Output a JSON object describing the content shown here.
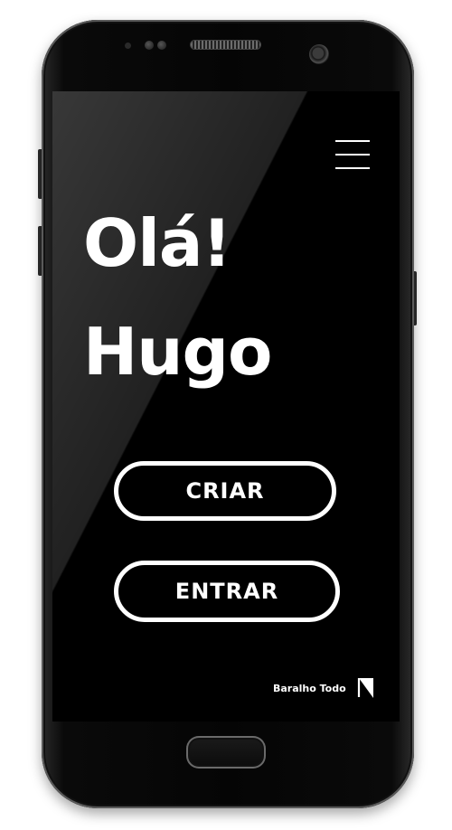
{
  "greeting": {
    "line1": "Olá!",
    "line2": "Hugo"
  },
  "actions": {
    "create_label": "CRIAR",
    "enter_label": "ENTRAR"
  },
  "brand": {
    "name": "Baralho Todo"
  },
  "icons": {
    "menu": "hamburger-menu-icon",
    "brand_logo": "baralho-todo-logo-icon"
  },
  "colors": {
    "background": "#000000",
    "foreground": "#ffffff"
  }
}
